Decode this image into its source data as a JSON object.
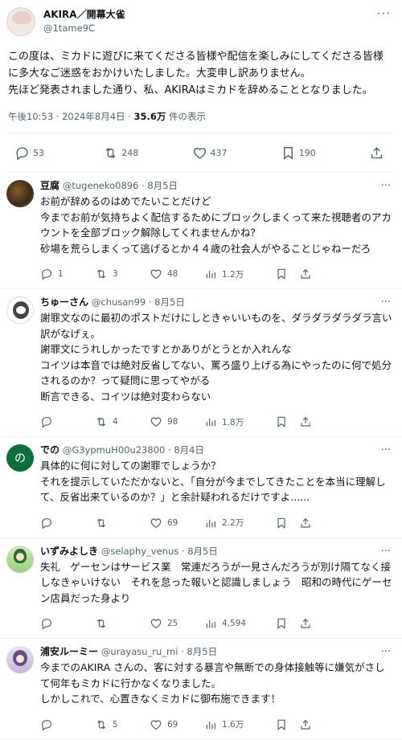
{
  "main_post": {
    "display_name": "AKIRA／開幕大雀",
    "handle": "@1tame9C",
    "text_lines": [
      "この度は、ミカドに遊びに来てくださる皆様や配信を楽しみにしてくださる皆様に多大なご迷惑をおかけいたしました。大変申し訳ありません。",
      "先ほど発表されました通り、私、AKIRAはミカドを辞めることとなりました。"
    ],
    "timestamp": "午後10:53 · 2024年8月4日 · ",
    "views_count": "35.6万",
    "views_label": " 件の表示",
    "stats": {
      "replies": "53",
      "reposts": "248",
      "likes": "437",
      "bookmarks": "190"
    }
  },
  "replies": [
    {
      "name": "豆腐",
      "handle": "@tugeneko0896",
      "date": " · 8月5日",
      "lines": [
        "お前が辞めるのはめでたいことだけど",
        "今までお前が気持ちよく配信するためにブロックしまくって来た視聴者のアカウントを全部ブロック解除してくれませんかね？",
        "砂場を荒らしまくって逃げるとか４４歳の社会人がやることじゃねーだろ"
      ],
      "replies": "1",
      "reposts": "3",
      "likes": "48",
      "views": "1.2万"
    },
    {
      "name": "ちゅーさん",
      "handle": "@chusan99",
      "date": " · 8月5日",
      "lines": [
        "謝罪文なのに最初のポストだけにしときゃいいものを、ダラダラダラダラ言い訳がなげぇ。",
        "謝罪文にうれしかったですとかありがとうとか入れんな",
        "コイツは本音では絶対反省してない、罵ろ盛り上げる為にやったのに何で処分されるのか？って疑問に思ってやがる",
        "断言できる、コイツは絶対変わらない"
      ],
      "replies": "",
      "reposts": "4",
      "likes": "98",
      "views": "1.8万"
    },
    {
      "name": "での",
      "handle": "@G3ypmuH00u23800",
      "date": " · 8月4日",
      "avatar_char": "の",
      "lines": [
        "具体的に何に対しての謝罪でしょうか？",
        "それを提示していただかないと、「自分が今までしてきたことを本当に理解して、反省出来ているのか？」と余計疑われるだけですよ......"
      ],
      "replies": "",
      "reposts": "",
      "likes": "69",
      "views": "2.2万"
    },
    {
      "name": "いずみよしき",
      "handle": "@selaphy_venus",
      "date": " · 8月5日",
      "lines": [
        "失礼　ゲーセンはサービス業　常連だろうが一見さんだろうが別け隔てなく接しなきゃいけない　それを怠った報いと認識しましょう　昭和の時代にゲーセン店員だった身より"
      ],
      "replies": "",
      "reposts": "",
      "likes": "25",
      "views": "4,594"
    },
    {
      "name": "浦安ルーミー",
      "handle": "@urayasu_ru_mi",
      "date": " · 8月5日",
      "lines": [
        "今までのAKIRA さんの、客に対する暴言や無断での身体接触等に嫌気がさして何年もミカドに行かなくなりました。",
        "しかしこれで、心置きなくミカドに御布施できます！"
      ],
      "replies": "",
      "reposts": "5",
      "likes": "69",
      "views": "1.6万"
    }
  ],
  "icons": {
    "reply": "reply-icon",
    "repost": "repost-icon",
    "like": "heart-icon",
    "views": "views-chart-icon",
    "bookmark": "bookmark-icon",
    "share": "share-icon",
    "more": "more-icon"
  },
  "colors": {
    "text": "#0f1419",
    "secondary": "#536471",
    "divider": "#eff3f4"
  }
}
